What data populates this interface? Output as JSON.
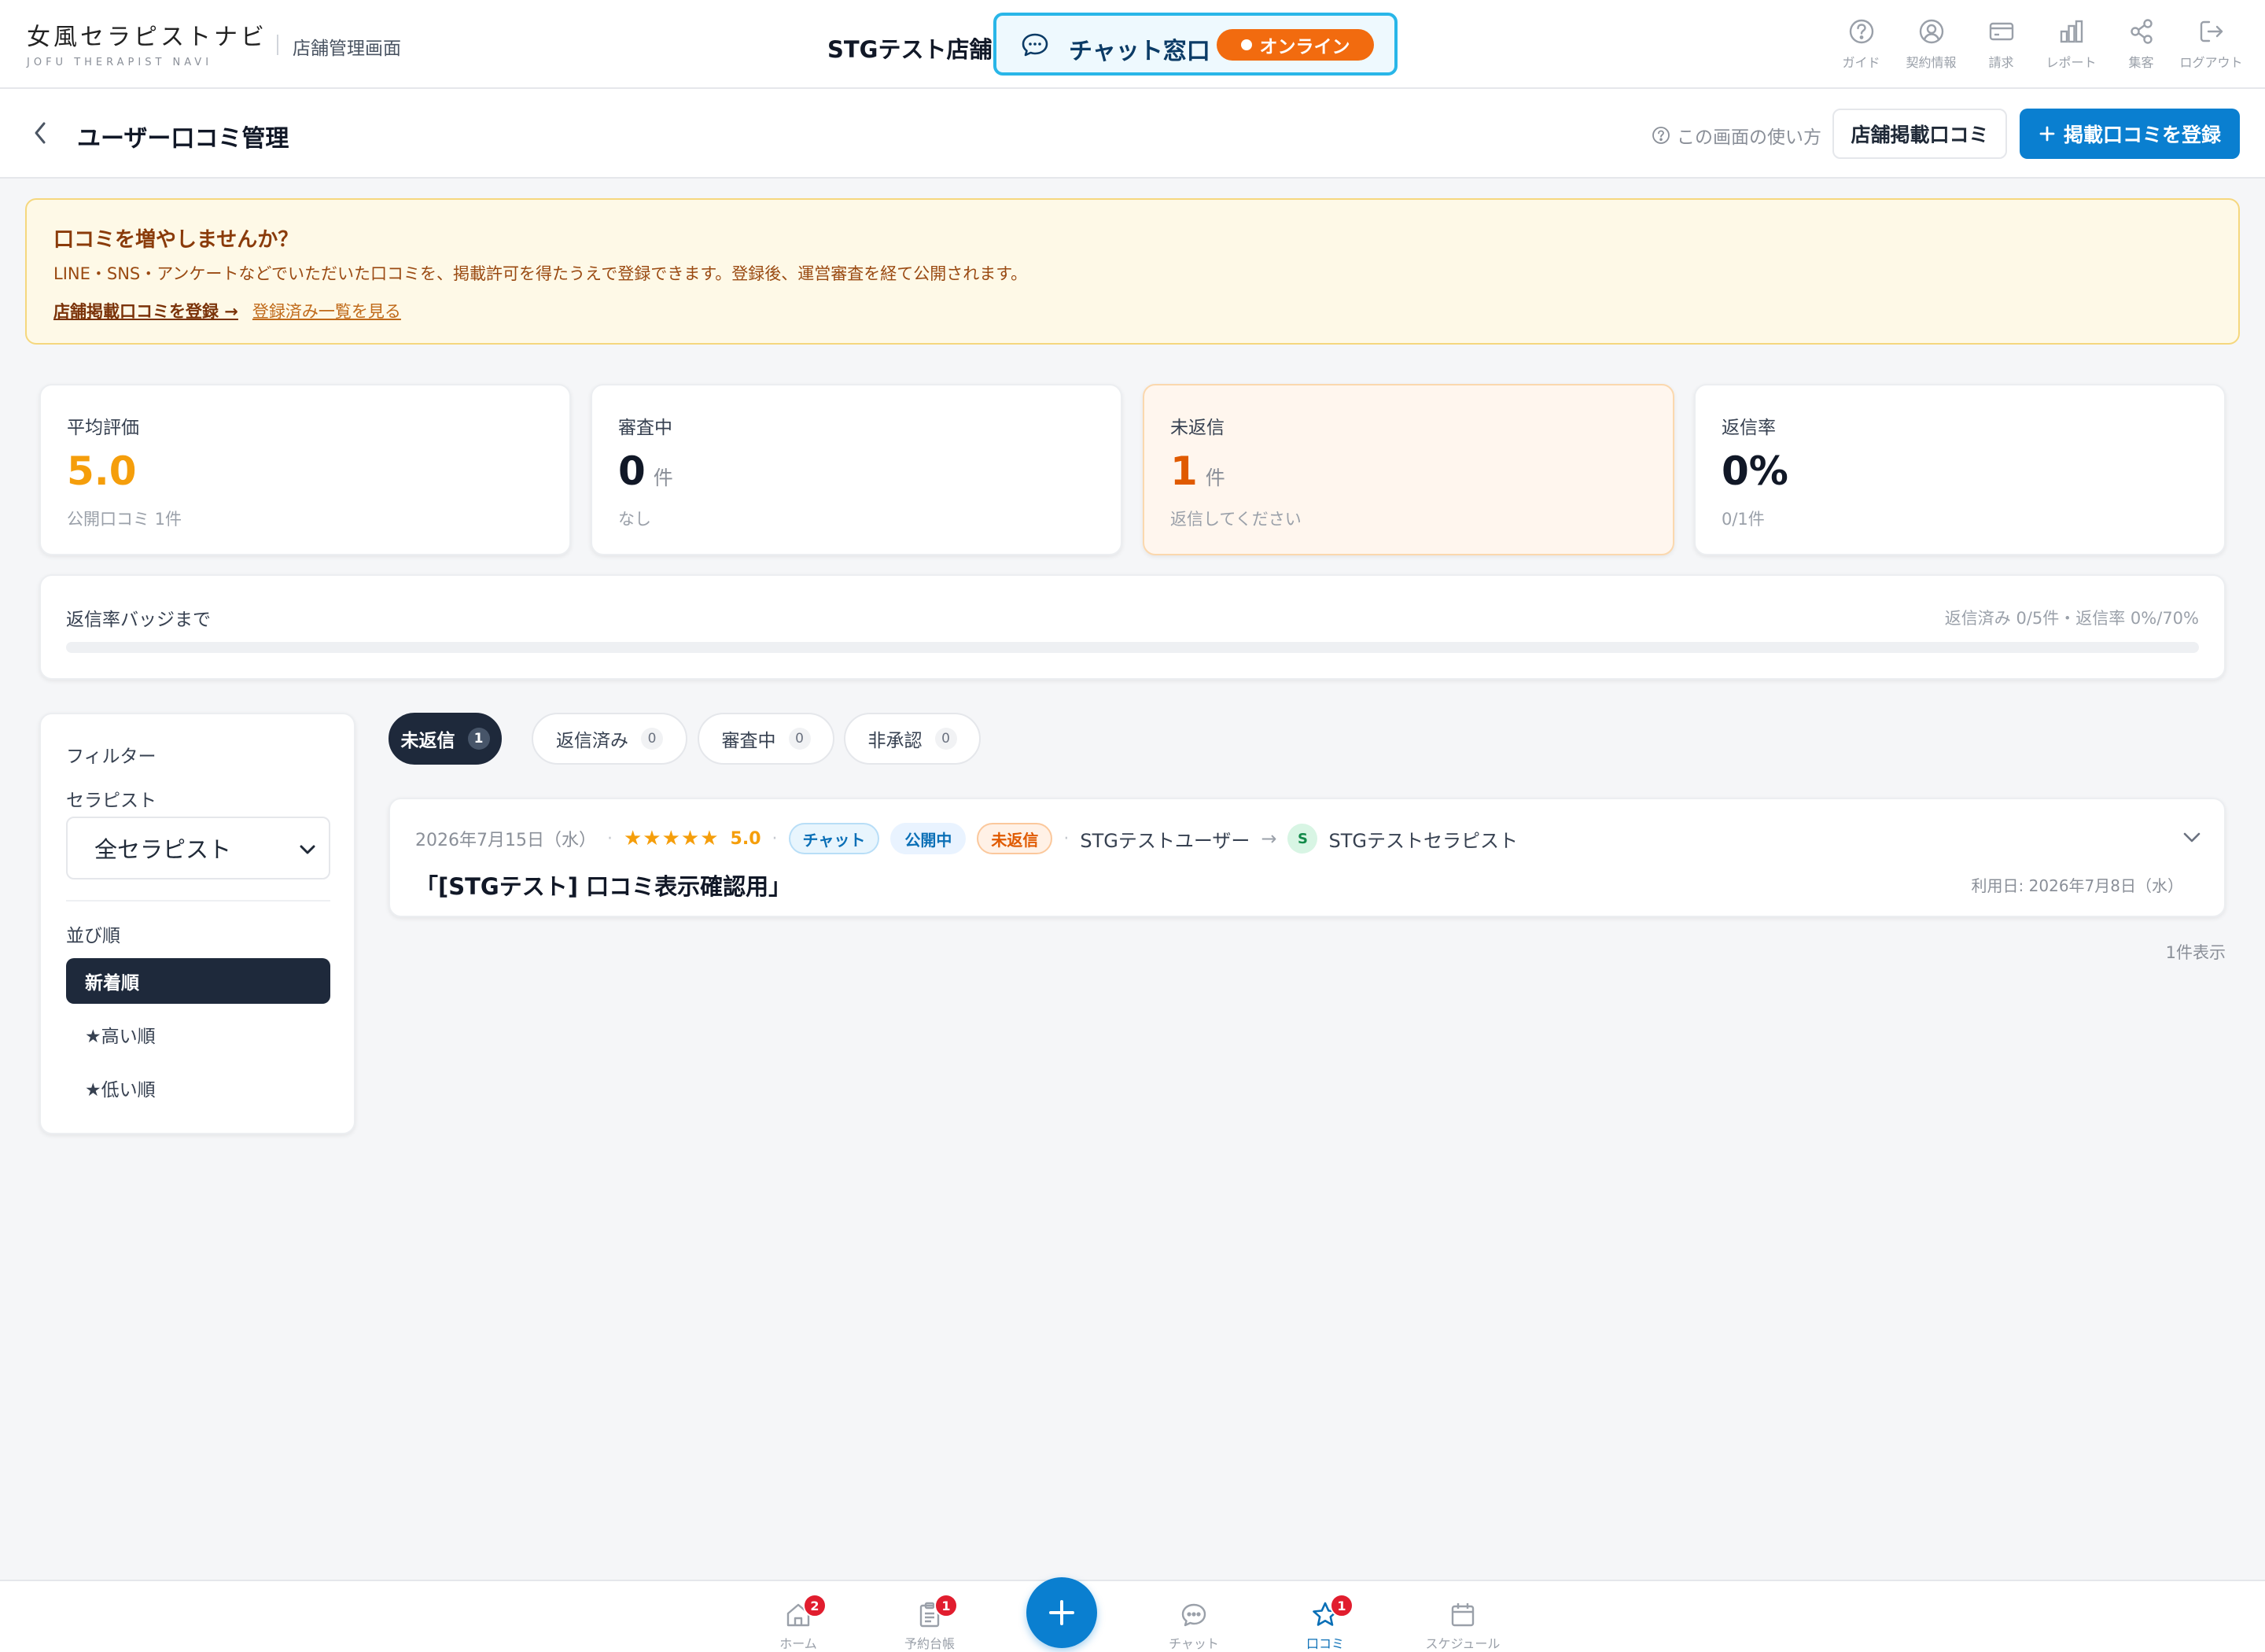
{
  "header": {
    "logo_main": "女風セラピストナビ",
    "logo_sub": "JOFU THERAPIST NAVI",
    "admin_label": "店舗管理画面",
    "store_name": "STGテスト店舗",
    "chat_label": "チャット窓口",
    "online_label": "オンライン",
    "nav": [
      {
        "label": "ガイド",
        "icon": "help-circle-icon"
      },
      {
        "label": "契約情報",
        "icon": "user-circle-icon"
      },
      {
        "label": "請求",
        "icon": "credit-card-icon"
      },
      {
        "label": "レポート",
        "icon": "bar-chart-icon"
      },
      {
        "label": "集客",
        "icon": "share-icon"
      },
      {
        "label": "ログアウト",
        "icon": "logout-icon"
      }
    ]
  },
  "page": {
    "title": "ユーザー口コミ管理",
    "help_label": "この画面の使い方",
    "store_reviews_button": "店舗掲載口コミ",
    "register_button": "掲載口コミを登録"
  },
  "notice": {
    "title": "口コミを増やしませんか？",
    "body": "LINE・SNS・アンケートなどでいただいた口コミを、掲載許可を得たうえで登録できます。登録後、運営審査を経て公開されます。",
    "link_register": "店舗掲載口コミを登録 →",
    "link_list": "登録済み一覧を見る"
  },
  "stats": [
    {
      "label": "平均評価",
      "value": "5.0",
      "unit": "",
      "sub": "公開口コミ 1件",
      "value_color": "#f59e0b"
    },
    {
      "label": "審査中",
      "value": "0",
      "unit": "件",
      "sub": "なし",
      "value_color": "#111827"
    },
    {
      "label": "未返信",
      "value": "1",
      "unit": "件",
      "sub": "返信してください",
      "value_color": "#e05a00"
    },
    {
      "label": "返信率",
      "value": "0%",
      "unit": "",
      "sub": "0/1件",
      "value_color": "#111827"
    }
  ],
  "badge_progress": {
    "label": "返信率バッジまで",
    "summary": "返信済み 0/5件・返信率 0%/70%",
    "progress": 0
  },
  "filter": {
    "title": "フィルター",
    "therapist_label": "セラピスト",
    "therapist_value": "全セラピスト",
    "sort_label": "並び順",
    "sort_options": [
      "新着順",
      "★高い順",
      "★低い順"
    ],
    "sort_selected": 0
  },
  "tabs": [
    {
      "label": "未返信",
      "count": "1"
    },
    {
      "label": "返信済み",
      "count": "0"
    },
    {
      "label": "審査中",
      "count": "0"
    },
    {
      "label": "非承認",
      "count": "0"
    }
  ],
  "reviews": [
    {
      "date": "2026年7月15日（水）",
      "stars": "★★★★★",
      "rating": "5.0",
      "channel": "チャット",
      "visibility": "公開中",
      "reply_status": "未返信",
      "user": "STGテストユーザー",
      "arrow": "→",
      "therapist_initial": "S",
      "therapist": "STGテストセラピスト",
      "title": "「[STGテスト] 口コミ表示確認用」",
      "use_date": "利用日: 2026年7月8日（水）"
    }
  ],
  "result_count": "1件表示",
  "bottom_nav": [
    {
      "label": "ホーム",
      "badge": "2",
      "icon": "home-icon"
    },
    {
      "label": "予約台帳",
      "badge": "1",
      "icon": "clipboard-icon"
    },
    {
      "label": "チャット",
      "badge": "",
      "icon": "chat-bubble-icon"
    },
    {
      "label": "口コミ",
      "badge": "1",
      "icon": "star-icon"
    },
    {
      "label": "スケジュール",
      "badge": "",
      "icon": "calendar-icon"
    }
  ],
  "colors": {
    "primary": "#0a7fd0",
    "accent_orange": "#f26b0f",
    "chat_border": "#29b6e8",
    "star": "#f59e0b",
    "badge_red": "#e11d2e"
  }
}
